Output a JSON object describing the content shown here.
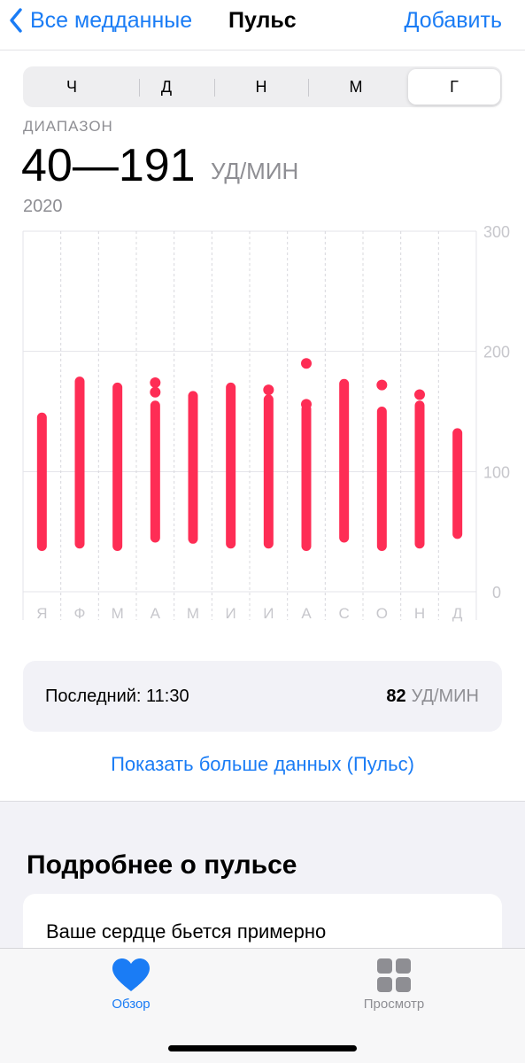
{
  "nav": {
    "back_label": "Все медданные",
    "title": "Пульс",
    "add_label": "Добавить"
  },
  "segments": [
    {
      "label": "Ч",
      "active": false
    },
    {
      "label": "Д",
      "active": false
    },
    {
      "label": "Н",
      "active": false
    },
    {
      "label": "М",
      "active": false
    },
    {
      "label": "Г",
      "active": true
    }
  ],
  "summary": {
    "label": "ДИАПАЗОН",
    "value": "40—191",
    "unit": "УД/МИН",
    "period": "2020"
  },
  "chart_data": {
    "type": "bar",
    "subtype": "range",
    "categories": [
      "Я",
      "Ф",
      "М",
      "А",
      "М",
      "И",
      "И",
      "А",
      "С",
      "О",
      "Н",
      "Д"
    ],
    "yticks": [
      "300",
      "200",
      "100",
      "0"
    ],
    "ylim": [
      0,
      300
    ],
    "grid": true,
    "color": "#fe2d55",
    "series": [
      {
        "ranges": [
          [
            38,
            145
          ],
          [
            40,
            175
          ],
          [
            38,
            170
          ],
          [
            45,
            155
          ],
          [
            44,
            163
          ],
          [
            40,
            170
          ],
          [
            40,
            160
          ],
          [
            38,
            152
          ],
          [
            45,
            173
          ],
          [
            38,
            150
          ],
          [
            40,
            155
          ],
          [
            48,
            132
          ]
        ],
        "extra_points": [
          [],
          [],
          [],
          [
            166,
            174
          ],
          [],
          [],
          [
            168
          ],
          [
            156,
            190
          ],
          [],
          [
            172
          ],
          [
            164
          ],
          []
        ]
      }
    ]
  },
  "latest": {
    "label": "Последний: 11:30",
    "value": "82",
    "unit": "УД/МИН"
  },
  "more_link": "Показать больше данных (Пульс)",
  "about": {
    "title": "Подробнее о пульсе",
    "text": "Ваше сердце бьется примерно"
  },
  "tabbar": {
    "tabs": [
      {
        "label": "Обзор",
        "icon": "heart-icon",
        "active": true
      },
      {
        "label": "Просмотр",
        "icon": "grid-icon",
        "active": false
      }
    ]
  },
  "colors": {
    "accent": "#1a7cf5",
    "chart": "#fe2d55",
    "secondary_text": "#8e8e93"
  }
}
